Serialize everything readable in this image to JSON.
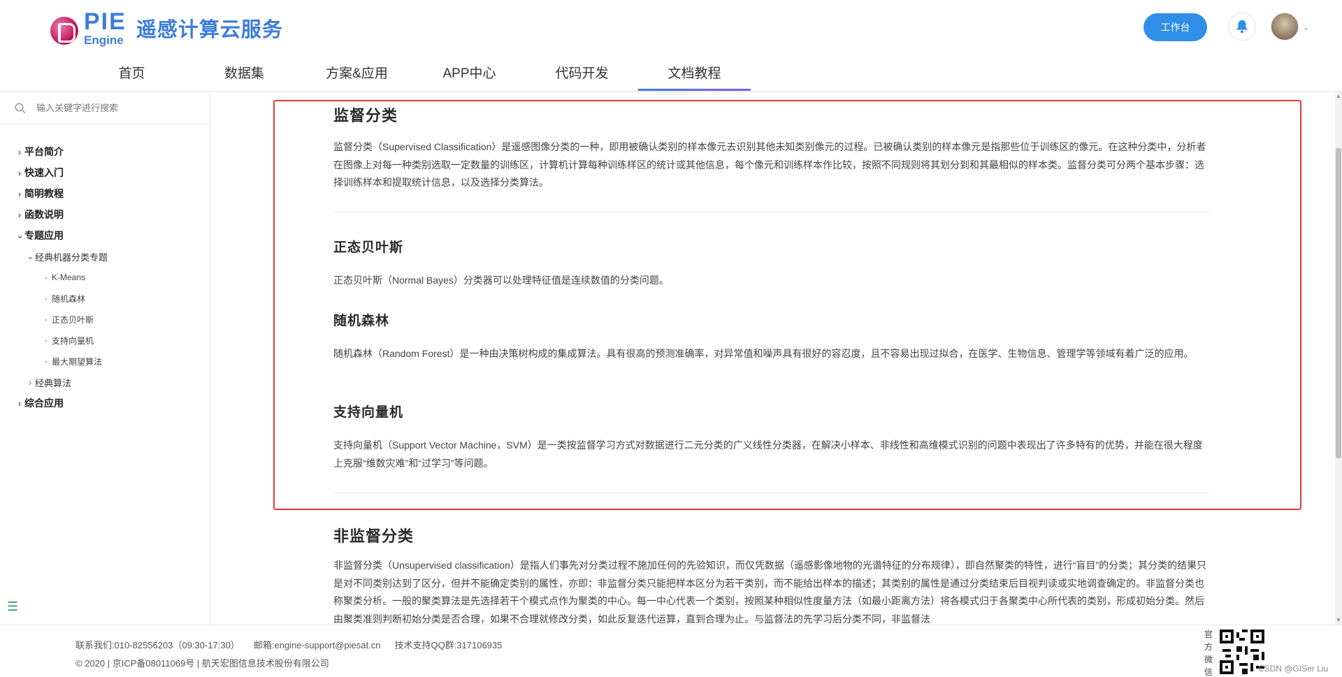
{
  "header": {
    "logo_pie": "PIE",
    "logo_engine": "Engine",
    "logo_title": "遥感计算云服务",
    "workbench_label": "工作台",
    "nav": [
      {
        "label": "首页"
      },
      {
        "label": "数据集"
      },
      {
        "label": "方案&应用"
      },
      {
        "label": "APP中心"
      },
      {
        "label": "代码开发"
      },
      {
        "label": "文档教程"
      }
    ],
    "active_nav": "文档教程"
  },
  "sidebar": {
    "search_placeholder": "输入关键字进行搜索",
    "tree": [
      {
        "label": "平台简介",
        "arrow": "›"
      },
      {
        "label": "快速入门",
        "arrow": "›"
      },
      {
        "label": "简明教程",
        "arrow": "›"
      },
      {
        "label": "函数说明",
        "arrow": "›"
      },
      {
        "label": "专题应用",
        "arrow": "⌄"
      },
      {
        "label": "经典机器分类专题",
        "arrow": "⌄"
      },
      {
        "label": "K-Means"
      },
      {
        "label": "随机森林"
      },
      {
        "label": "正态贝叶斯"
      },
      {
        "label": "支持向量机"
      },
      {
        "label": "最大期望算法"
      },
      {
        "label": "经典算法",
        "arrow": "›"
      },
      {
        "label": "综合应用",
        "arrow": "›"
      }
    ]
  },
  "article": {
    "supervised_title": "监督分类",
    "supervised_text": "监督分类（Supervised Classification）是遥感图像分类的一种，即用被确认类别的样本像元去识别其他未知类别像元的过程。已被确认类别的样本像元是指那些位于训练区的像元。在这种分类中，分析者在图像上对每一种类别选取一定数量的训练区，计算机计算每种训练样区的统计或其他信息，每个像元和训练样本作比较，按照不同规则将其划分到和其最相似的样本类。监督分类可分两个基本步骤：选择训练样本和提取统计信息，以及选择分类算法。",
    "bayes_title": "正态贝叶斯",
    "bayes_text": "正态贝叶斯（Normal Bayes）分类器可以处理特征值是连续数值的分类问题。",
    "rf_title": "随机森林",
    "rf_text": "随机森林（Random Forest）是一种由决策树构成的集成算法。具有很高的预测准确率，对异常值和噪声具有很好的容忍度，且不容易出现过拟合，在医学、生物信息、管理学等领域有着广泛的应用。",
    "svm_title": "支持向量机",
    "svm_text": "支持向量机（Support Vector Machine，SVM）是一类按监督学习方式对数据进行二元分类的广义线性分类器，在解决小样本、非线性和高维模式识别的问题中表现出了许多特有的优势，并能在很大程度上克服“维数灾难”和“过学习”等问题。",
    "unsupervised_title": "非监督分类",
    "unsupervised_text": "非监督分类（Unsupervised classification）是指人们事先对分类过程不施加任何的先验知识，而仅凭数据（遥感影像地物的光谱特征的分布规律），即自然聚类的特性，进行“盲目”的分类；其分类的结果只是对不同类别达到了区分，但并不能确定类别的属性，亦即：非监督分类只能把样本区分为若干类别，而不能给出样本的描述；其类别的属性是通过分类结束后目视判读或实地调查确定的。非监督分类也称聚类分析。一般的聚类算法是先选择若干个模式点作为聚类的中心。每一中心代表一个类别，按照某种相似性度量方法（如最小距离方法）将各模式归于各聚类中心所代表的类别，形成初始分类。然后由聚类准则判断初始分类是否合理，如果不合理就修改分类，如此反复迭代运算，直到合理为止。与监督法的先学习后分类不同，非监督法"
  },
  "footer": {
    "contact": "联系我们:010-82556203（09:30-17:30）",
    "email": "邮箱:engine-support@piesat.cn",
    "qq": "技术支持QQ群:317106935",
    "copyright": "© 2020 | 京ICP备08011069号 | 航天宏图信息技术股份有限公司",
    "qr_label": "官方微信",
    "watermark": "CSDN @GISer Liu"
  },
  "colors": {
    "brand": "#3d7dd8",
    "button": "#2f8fe8",
    "highlight_border": "#e53935",
    "nav_underline_start": "#3d7dd8",
    "nav_underline_end": "#8a5de0"
  }
}
